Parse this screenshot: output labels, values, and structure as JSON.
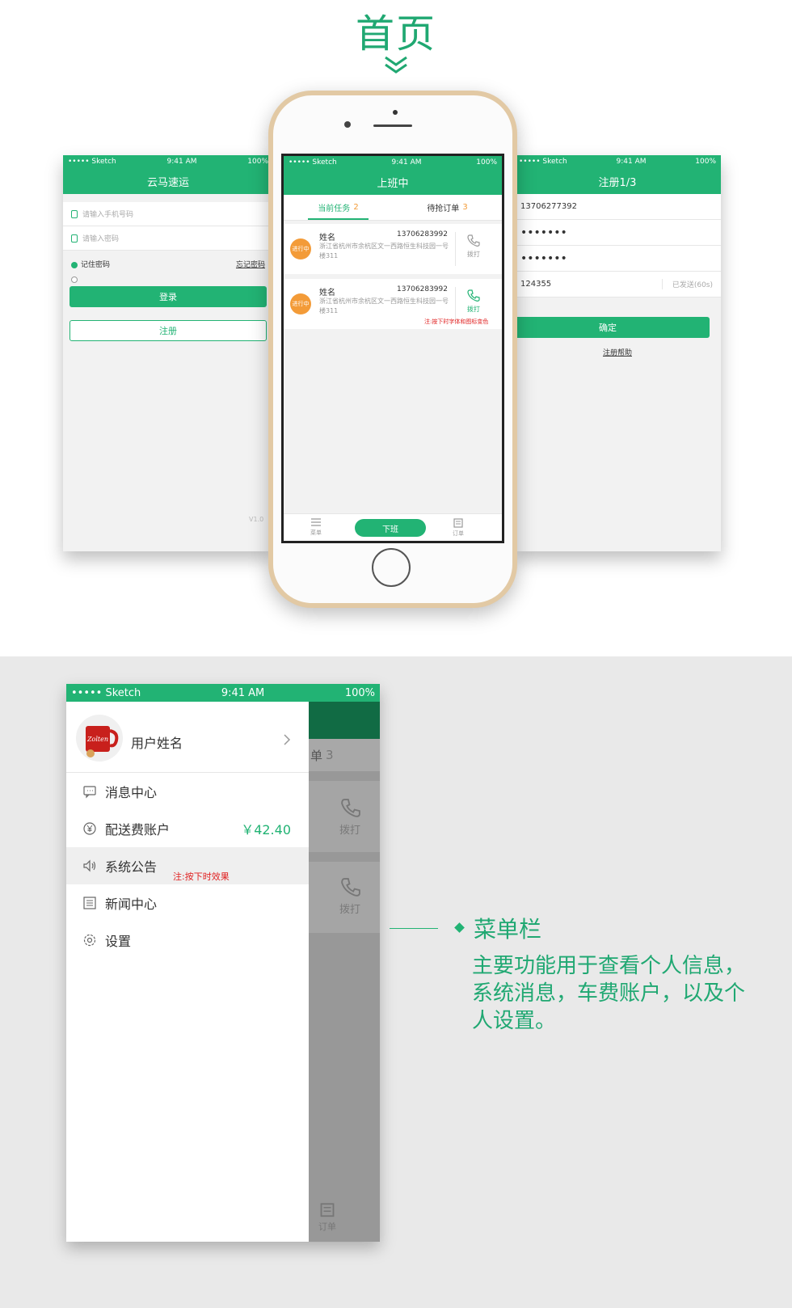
{
  "heading": "首页",
  "status": {
    "carrier": "••••• Sketch",
    "time": "9:41 AM",
    "battery": "100%"
  },
  "login": {
    "title": "云马速运",
    "phone_placeholder": "请输入手机号码",
    "password_placeholder": "请输入密码",
    "remember": "记住密码",
    "forgot": "忘记密码",
    "login_btn": "登录",
    "register_btn": "注册",
    "version": "V1.0"
  },
  "register": {
    "title": "注册1/3",
    "phone": "13706277392",
    "password": "•••••••",
    "confirm": "•••••••",
    "code": "124355",
    "sent": "已发送(60s)",
    "confirm_btn": "确定",
    "help": "注册帮助"
  },
  "home": {
    "title": "上班中",
    "tab_current": "当前任务",
    "tab_current_count": "2",
    "tab_pending": "待抢订单",
    "tab_pending_count": "3",
    "orders": [
      {
        "badge": "进行中",
        "name": "姓名",
        "phone": "13706283992",
        "addr": "浙江省杭州市余杭区文一西路恒生科技园一号楼311",
        "call": "拨打"
      },
      {
        "badge": "进行中",
        "name": "姓名",
        "phone": "13706283992",
        "addr": "浙江省杭州市余杭区文一西路恒生科技园一号楼311",
        "call": "拨打"
      }
    ],
    "press_note": "注:按下时字体和图标变色",
    "offwork": "下班",
    "menu_label": "菜单",
    "order_label": "订单"
  },
  "menu": {
    "user_name": "用户姓名",
    "avatar_text": "Zolten",
    "items": [
      {
        "label": "消息中心",
        "icon": "message-icon"
      },
      {
        "label": "配送费账户",
        "icon": "yuan-icon",
        "value": "￥42.40"
      },
      {
        "label": "系统公告",
        "icon": "speaker-icon"
      },
      {
        "label": "新闻中心",
        "icon": "news-icon"
      },
      {
        "label": "设置",
        "icon": "gear-icon"
      }
    ],
    "press_note": "注:按下时效果",
    "bg_tab": "单",
    "bg_tab_count": "3",
    "bg_call": "拨打",
    "bg_order": "订单"
  },
  "callout": {
    "title": "菜单栏",
    "body": "主要功能用于查看个人信息，系统消息，车费账户，以及个人设置。"
  },
  "colors": {
    "brand_green": "#22b374",
    "accent_orange": "#f39b38",
    "note_red": "#e02020"
  }
}
